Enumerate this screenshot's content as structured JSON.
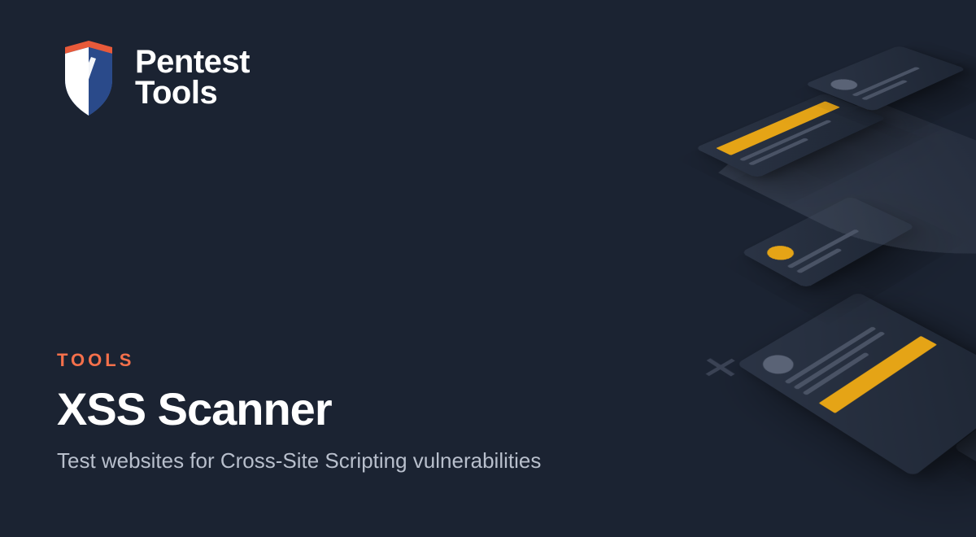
{
  "brand": {
    "line1": "Pentest",
    "line2": "Tools"
  },
  "category": "TOOLS",
  "title": "XSS Scanner",
  "subtitle": "Test websites for Cross-Site Scripting vulnerabilities",
  "colors": {
    "accent": "#f5704b",
    "highlight": "#e5a416"
  }
}
